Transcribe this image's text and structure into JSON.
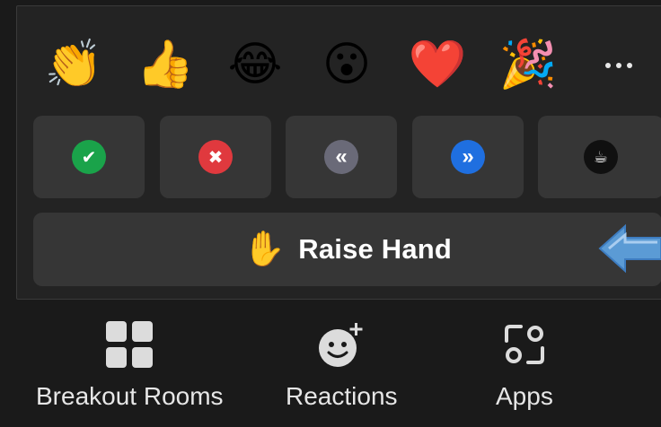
{
  "reactions": {
    "emojis": [
      {
        "name": "clapping-hands",
        "glyph": "👏"
      },
      {
        "name": "thumbs-up",
        "glyph": "👍"
      },
      {
        "name": "tears-of-joy",
        "glyph": "😂"
      },
      {
        "name": "open-mouth",
        "glyph": "😮"
      },
      {
        "name": "red-heart",
        "glyph": "❤️"
      },
      {
        "name": "party-popper",
        "glyph": "🎉"
      }
    ],
    "more_icon": "ellipsis-icon",
    "feedback_buttons": [
      {
        "name": "yes",
        "glyph": "✔",
        "color": "#1aa34a"
      },
      {
        "name": "no",
        "glyph": "✖",
        "color": "#e0393e"
      },
      {
        "name": "slow-down",
        "glyph": "«",
        "color": "#6a6a78"
      },
      {
        "name": "speed-up",
        "glyph": "»",
        "color": "#1f6fe0"
      },
      {
        "name": "coffee",
        "glyph": "☕",
        "color": "#101010"
      }
    ],
    "raise_hand": {
      "glyph": "✋",
      "label": "Raise Hand"
    }
  },
  "toolbar": {
    "breakout_rooms": "Breakout Rooms",
    "reactions": "Reactions",
    "apps": "Apps"
  },
  "colors": {
    "background": "#1a1a1a",
    "panel": "#232323",
    "button": "#363636",
    "arrow": "#5b9bd5"
  }
}
